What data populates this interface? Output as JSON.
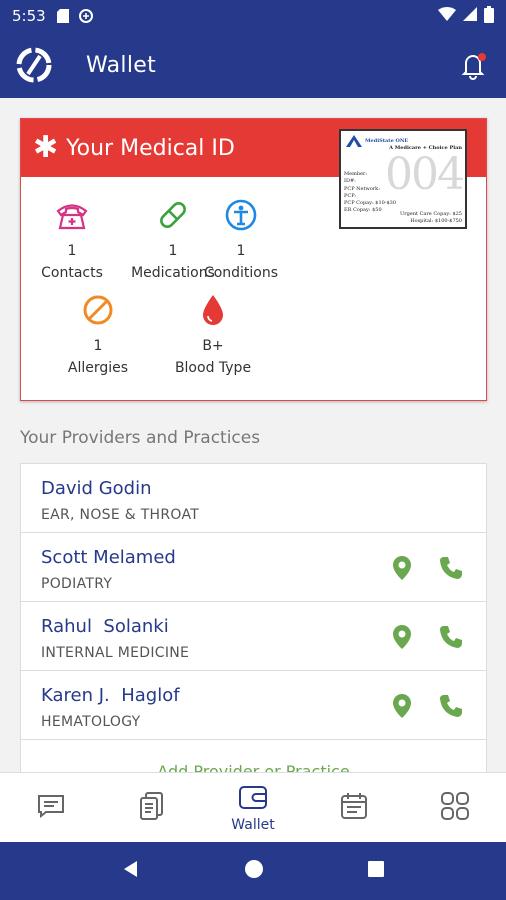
{
  "status_bar": {
    "time": "5:53"
  },
  "app_bar": {
    "title": "Wallet"
  },
  "medical_id": {
    "title": "Your Medical ID",
    "insurance_card": {
      "brand": "MediState ONE",
      "plan": "A Medicare + Choice Plan",
      "number": "004",
      "lines": [
        "Member:",
        "ID#:",
        "PCP Network:",
        "PCP:",
        "PCP Copay: $10-$30",
        "ER Copay: $50"
      ],
      "right_lines": [
        "Urgent Care Copay: $25",
        "Hospital: $100-$750"
      ]
    },
    "stats": [
      {
        "count": "1",
        "label": "Contacts"
      },
      {
        "count": "1",
        "label": "Medications"
      },
      {
        "count": "1",
        "label": "Conditions"
      },
      {
        "count": "1",
        "label": "Allergies"
      },
      {
        "count": "B+",
        "label": "Blood Type"
      }
    ],
    "colors": {
      "header": "#e53935",
      "contacts": "#d63384",
      "medications": "#3ca33c",
      "conditions": "#1e88e5",
      "allergies": "#f08a24",
      "blood": "#e53935"
    }
  },
  "providers": {
    "section_title": "Your Providers and Practices",
    "items": [
      {
        "name": "David Godin",
        "specialty": "EAR, NOSE & THROAT"
      },
      {
        "name": "Scott Melamed",
        "specialty": "PODIATRY"
      },
      {
        "name": "Rahul  Solanki",
        "specialty": "INTERNAL MEDICINE"
      },
      {
        "name": "Karen J.  Haglof",
        "specialty": "HEMATOLOGY"
      }
    ],
    "add_label": "Add Provider or Practice"
  },
  "bottom_nav": {
    "items": [
      {
        "icon": "chat-icon",
        "label": ""
      },
      {
        "icon": "documents-icon",
        "label": ""
      },
      {
        "icon": "wallet-icon",
        "label": "Wallet"
      },
      {
        "icon": "calendar-icon",
        "label": ""
      },
      {
        "icon": "grid-icon",
        "label": ""
      }
    ]
  },
  "theme": {
    "primary": "#26398a",
    "accent_green": "#6aa84f"
  }
}
